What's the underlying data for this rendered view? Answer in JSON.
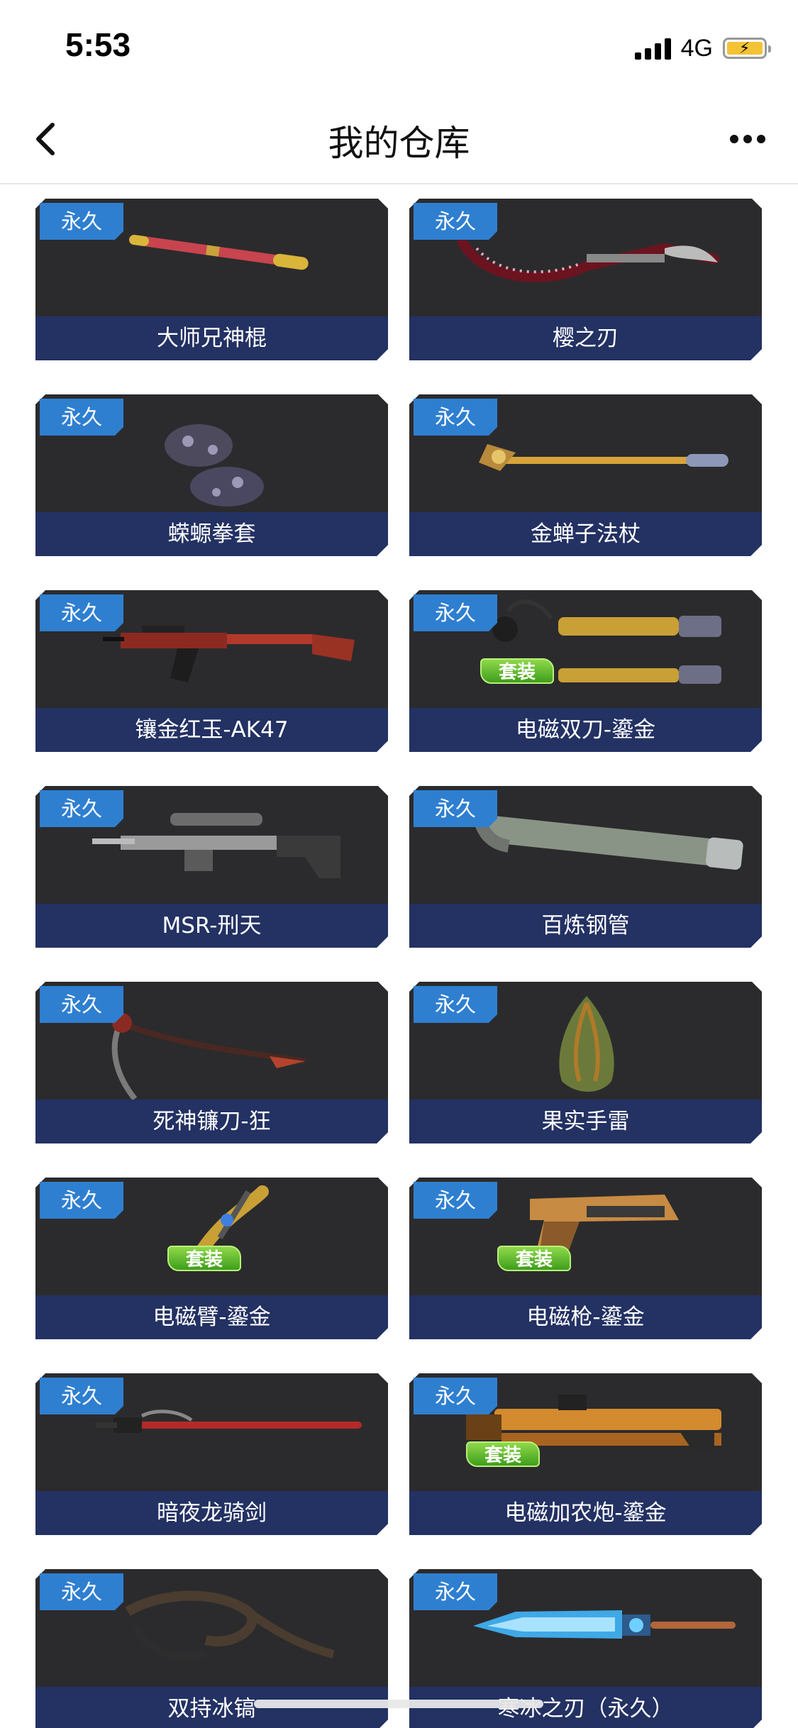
{
  "status_bar": {
    "time": "5:53",
    "network": "4G"
  },
  "nav": {
    "title": "我的仓库"
  },
  "colors": {
    "card_background": "#2b2b2d",
    "card_footer": "#233163",
    "badge_blue": "#2f7fd0",
    "set_badge_green": "#5bbf2a"
  },
  "items": [
    {
      "name": "大师兄神棍",
      "badge": "永久",
      "icon": "staff-icon"
    },
    {
      "name": "樱之刃",
      "badge": "永久",
      "icon": "scythe-blade-icon"
    },
    {
      "name": "蝾螈拳套",
      "badge": "永久",
      "icon": "gauntlet-icon"
    },
    {
      "name": "金蝉子法杖",
      "badge": "永久",
      "icon": "golden-staff-icon"
    },
    {
      "name": "镶金红玉-AK47",
      "badge": "永久",
      "icon": "rifle-icon"
    },
    {
      "name": "电磁双刀-鎏金",
      "badge": "永久",
      "set_label": "套装",
      "icon": "dual-blade-icon"
    },
    {
      "name": "MSR-刑天",
      "badge": "永久",
      "icon": "sniper-rifle-icon"
    },
    {
      "name": "百炼钢管",
      "badge": "永久",
      "icon": "steel-pipe-icon"
    },
    {
      "name": "死神镰刀-狂",
      "badge": "永久",
      "icon": "scythe-icon"
    },
    {
      "name": "果实手雷",
      "badge": "永久",
      "icon": "grenade-icon"
    },
    {
      "name": "电磁臂-鎏金",
      "badge": "永久",
      "set_label": "套装",
      "icon": "arm-blade-icon"
    },
    {
      "name": "电磁枪-鎏金",
      "badge": "永久",
      "set_label": "套装",
      "icon": "pistol-icon"
    },
    {
      "name": "暗夜龙骑剑",
      "badge": "永久",
      "icon": "sword-icon"
    },
    {
      "name": "电磁加农炮-鎏金",
      "badge": "永久",
      "set_label": "套装",
      "icon": "cannon-icon"
    },
    {
      "name": "双持冰镐",
      "badge": "永久",
      "icon": "ice-axe-icon"
    },
    {
      "name": "寒冰之刃（永久）",
      "badge": "永久",
      "icon": "ice-sword-icon"
    }
  ]
}
